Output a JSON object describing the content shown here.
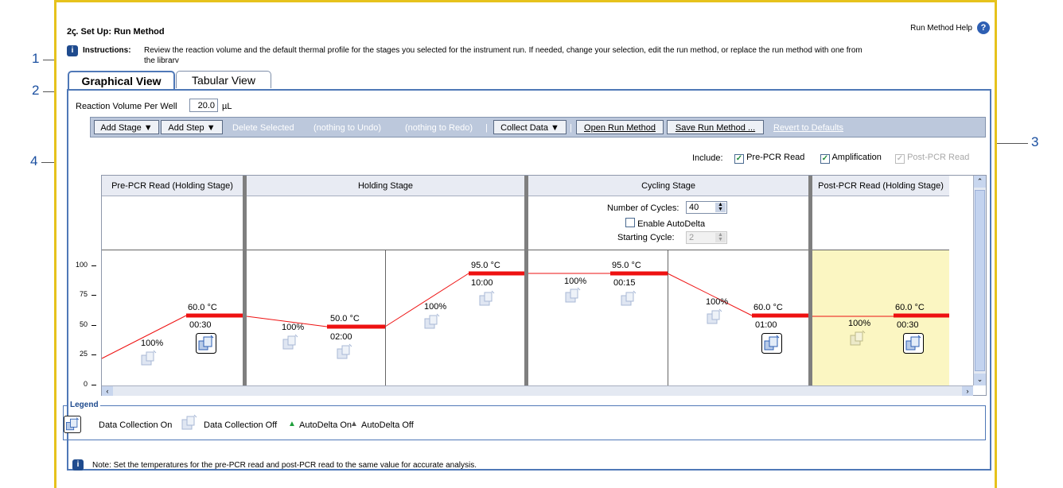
{
  "callouts": [
    "1",
    "2",
    "3",
    "4"
  ],
  "window": {
    "title": "2ꞔ. Set Up: Run Method",
    "help_label": "Run Method Help",
    "help_icon": "help-icon"
  },
  "instructions": {
    "label": "Instructions:",
    "text": "Review the reaction volume and the default thermal profile for the stages you selected for the instrument run. If needed, change your selection, edit the run method, or replace the run method with one from",
    "text2": "the library"
  },
  "tabs": [
    {
      "label": "Graphical View",
      "active": true
    },
    {
      "label": "Tabular View",
      "active": false
    }
  ],
  "reaction_volume": {
    "label": "Reaction Volume Per Well",
    "value": "20.0",
    "unit": "µL"
  },
  "toolbar": {
    "add_stage": "Add Stage ▼",
    "add_step": "Add Step ▼",
    "delete_selected": "Delete Selected",
    "undo": "(nothing to Undo)",
    "redo": "(nothing to Redo)",
    "sep": "|",
    "collect_data": "Collect Data ▼",
    "open_run_method": "Open Run Method",
    "save_run_method": "Save Run Method ...",
    "revert": "Revert to Defaults"
  },
  "include": {
    "label": "Include:",
    "pre_pcr": {
      "label": "Pre-PCR Read",
      "checked": true
    },
    "amplification": {
      "label": "Amplification",
      "checked": true
    },
    "post_pcr": {
      "label": "Post-PCR Read",
      "checked": true,
      "disabled": true
    }
  },
  "stages": [
    {
      "name": "Pre-PCR Read (Holding Stage)"
    },
    {
      "name": "Holding Stage"
    },
    {
      "name": "Cycling Stage"
    },
    {
      "name": "Post-PCR Read (Holding Stage)"
    }
  ],
  "cycling": {
    "cycles_label": "Number of Cycles:",
    "cycles_value": "40",
    "autodelta_label": "Enable AutoDelta",
    "starting_cycle_label": "Starting Cycle:",
    "starting_cycle_value": "2"
  },
  "y_axis": {
    "ticks": [
      "100",
      "75",
      "50",
      "25",
      "0"
    ],
    "ylim": [
      0,
      100
    ]
  },
  "steps": [
    {
      "temp": "60.0 °C",
      "time": "00:30",
      "ramp": "100%",
      "temp_value": 60
    },
    {
      "temp": "50.0 °C",
      "time": "02:00",
      "ramp": "100%",
      "temp_value": 50
    },
    {
      "temp": "95.0 °C",
      "time": "10:00",
      "ramp": "100%",
      "temp_value": 95
    },
    {
      "temp": "95.0 °C",
      "time": "00:15",
      "ramp": "100%",
      "temp_value": 95
    },
    {
      "temp": "60.0 °C",
      "time": "01:00",
      "ramp": "100%",
      "temp_value": 60
    },
    {
      "temp": "60.0 °C",
      "time": "00:30",
      "ramp": "100%",
      "temp_value": 60
    }
  ],
  "legend": {
    "title": "Legend",
    "dc_on": "Data Collection On",
    "dc_off": "Data Collection Off",
    "ad_on": "AutoDelta On",
    "ad_off": "AutoDelta Off",
    "ad_on_color": "#1e9e3a",
    "ad_off_color": "#555555"
  },
  "note": "Note: Set the temperatures for the pre-PCR read and post-PCR read to the same value for accurate analysis.",
  "colors": {
    "hold_line": "#ee1111",
    "ramp_line": "#ee1111",
    "post_pcr_bg": "#fbf6c2",
    "accent": "#4f78b7",
    "frame": "#e6c21c"
  }
}
